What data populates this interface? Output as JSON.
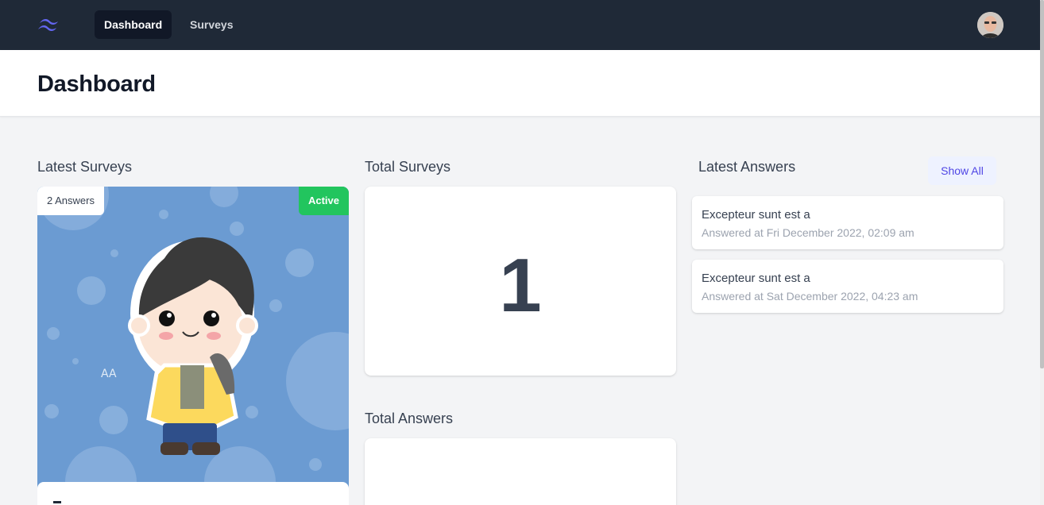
{
  "nav": {
    "logo_icon": "tailwind-logo-icon",
    "items": [
      {
        "label": "Dashboard",
        "active": true
      },
      {
        "label": "Surveys",
        "active": false
      }
    ],
    "avatar_icon": "user-avatar"
  },
  "header": {
    "title": "Dashboard"
  },
  "latest_surveys": {
    "title": "Latest Surveys",
    "card": {
      "answers_badge": "2 Answers",
      "status_badge": "Active",
      "status_color": "#22c55e"
    }
  },
  "total_surveys": {
    "title": "Total Surveys",
    "value": "1"
  },
  "total_answers": {
    "title": "Total Answers"
  },
  "latest_answers": {
    "title": "Latest Answers",
    "show_all_label": "Show All",
    "items": [
      {
        "title": "Excepteur sunt est a",
        "date": "Answered at Fri December 2022, 02:09 am"
      },
      {
        "title": "Excepteur sunt est a",
        "date": "Answered at Sat December 2022, 04:23 am"
      }
    ]
  },
  "colors": {
    "nav_bg": "#1f2937",
    "accent": "#4f46e5",
    "page_bg": "#f3f4f6"
  }
}
